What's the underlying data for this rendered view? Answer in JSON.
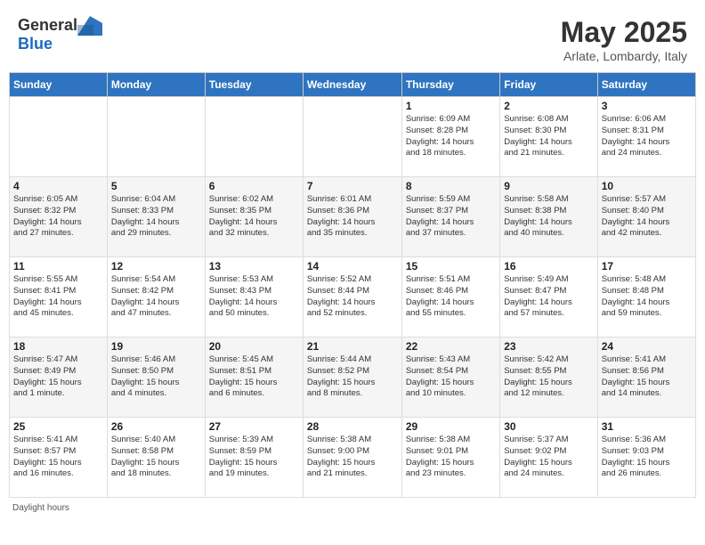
{
  "header": {
    "logo_general": "General",
    "logo_blue": "Blue",
    "title": "May 2025",
    "location": "Arlate, Lombardy, Italy"
  },
  "weekdays": [
    "Sunday",
    "Monday",
    "Tuesday",
    "Wednesday",
    "Thursday",
    "Friday",
    "Saturday"
  ],
  "weeks": [
    [
      {
        "day": "",
        "info": ""
      },
      {
        "day": "",
        "info": ""
      },
      {
        "day": "",
        "info": ""
      },
      {
        "day": "",
        "info": ""
      },
      {
        "day": "1",
        "info": "Sunrise: 6:09 AM\nSunset: 8:28 PM\nDaylight: 14 hours\nand 18 minutes."
      },
      {
        "day": "2",
        "info": "Sunrise: 6:08 AM\nSunset: 8:30 PM\nDaylight: 14 hours\nand 21 minutes."
      },
      {
        "day": "3",
        "info": "Sunrise: 6:06 AM\nSunset: 8:31 PM\nDaylight: 14 hours\nand 24 minutes."
      }
    ],
    [
      {
        "day": "4",
        "info": "Sunrise: 6:05 AM\nSunset: 8:32 PM\nDaylight: 14 hours\nand 27 minutes."
      },
      {
        "day": "5",
        "info": "Sunrise: 6:04 AM\nSunset: 8:33 PM\nDaylight: 14 hours\nand 29 minutes."
      },
      {
        "day": "6",
        "info": "Sunrise: 6:02 AM\nSunset: 8:35 PM\nDaylight: 14 hours\nand 32 minutes."
      },
      {
        "day": "7",
        "info": "Sunrise: 6:01 AM\nSunset: 8:36 PM\nDaylight: 14 hours\nand 35 minutes."
      },
      {
        "day": "8",
        "info": "Sunrise: 5:59 AM\nSunset: 8:37 PM\nDaylight: 14 hours\nand 37 minutes."
      },
      {
        "day": "9",
        "info": "Sunrise: 5:58 AM\nSunset: 8:38 PM\nDaylight: 14 hours\nand 40 minutes."
      },
      {
        "day": "10",
        "info": "Sunrise: 5:57 AM\nSunset: 8:40 PM\nDaylight: 14 hours\nand 42 minutes."
      }
    ],
    [
      {
        "day": "11",
        "info": "Sunrise: 5:55 AM\nSunset: 8:41 PM\nDaylight: 14 hours\nand 45 minutes."
      },
      {
        "day": "12",
        "info": "Sunrise: 5:54 AM\nSunset: 8:42 PM\nDaylight: 14 hours\nand 47 minutes."
      },
      {
        "day": "13",
        "info": "Sunrise: 5:53 AM\nSunset: 8:43 PM\nDaylight: 14 hours\nand 50 minutes."
      },
      {
        "day": "14",
        "info": "Sunrise: 5:52 AM\nSunset: 8:44 PM\nDaylight: 14 hours\nand 52 minutes."
      },
      {
        "day": "15",
        "info": "Sunrise: 5:51 AM\nSunset: 8:46 PM\nDaylight: 14 hours\nand 55 minutes."
      },
      {
        "day": "16",
        "info": "Sunrise: 5:49 AM\nSunset: 8:47 PM\nDaylight: 14 hours\nand 57 minutes."
      },
      {
        "day": "17",
        "info": "Sunrise: 5:48 AM\nSunset: 8:48 PM\nDaylight: 14 hours\nand 59 minutes."
      }
    ],
    [
      {
        "day": "18",
        "info": "Sunrise: 5:47 AM\nSunset: 8:49 PM\nDaylight: 15 hours\nand 1 minute."
      },
      {
        "day": "19",
        "info": "Sunrise: 5:46 AM\nSunset: 8:50 PM\nDaylight: 15 hours\nand 4 minutes."
      },
      {
        "day": "20",
        "info": "Sunrise: 5:45 AM\nSunset: 8:51 PM\nDaylight: 15 hours\nand 6 minutes."
      },
      {
        "day": "21",
        "info": "Sunrise: 5:44 AM\nSunset: 8:52 PM\nDaylight: 15 hours\nand 8 minutes."
      },
      {
        "day": "22",
        "info": "Sunrise: 5:43 AM\nSunset: 8:54 PM\nDaylight: 15 hours\nand 10 minutes."
      },
      {
        "day": "23",
        "info": "Sunrise: 5:42 AM\nSunset: 8:55 PM\nDaylight: 15 hours\nand 12 minutes."
      },
      {
        "day": "24",
        "info": "Sunrise: 5:41 AM\nSunset: 8:56 PM\nDaylight: 15 hours\nand 14 minutes."
      }
    ],
    [
      {
        "day": "25",
        "info": "Sunrise: 5:41 AM\nSunset: 8:57 PM\nDaylight: 15 hours\nand 16 minutes."
      },
      {
        "day": "26",
        "info": "Sunrise: 5:40 AM\nSunset: 8:58 PM\nDaylight: 15 hours\nand 18 minutes."
      },
      {
        "day": "27",
        "info": "Sunrise: 5:39 AM\nSunset: 8:59 PM\nDaylight: 15 hours\nand 19 minutes."
      },
      {
        "day": "28",
        "info": "Sunrise: 5:38 AM\nSunset: 9:00 PM\nDaylight: 15 hours\nand 21 minutes."
      },
      {
        "day": "29",
        "info": "Sunrise: 5:38 AM\nSunset: 9:01 PM\nDaylight: 15 hours\nand 23 minutes."
      },
      {
        "day": "30",
        "info": "Sunrise: 5:37 AM\nSunset: 9:02 PM\nDaylight: 15 hours\nand 24 minutes."
      },
      {
        "day": "31",
        "info": "Sunrise: 5:36 AM\nSunset: 9:03 PM\nDaylight: 15 hours\nand 26 minutes."
      }
    ]
  ],
  "footer": {
    "daylight_label": "Daylight hours"
  }
}
